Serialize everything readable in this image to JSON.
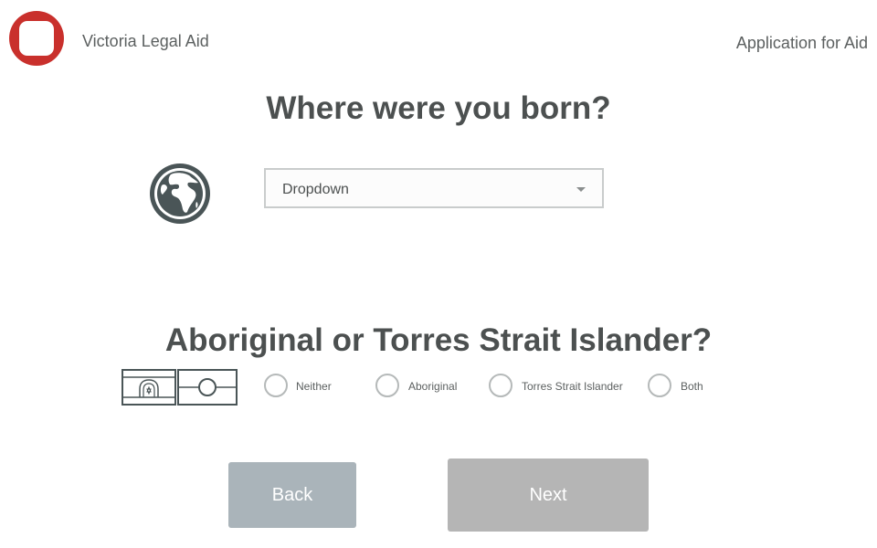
{
  "header": {
    "org_name": "Victoria Legal Aid",
    "app_title": "Application for Aid",
    "logo_icon": "vla-logo-icon",
    "brand_color": "#c9302c"
  },
  "birthplace": {
    "question": "Where were you born?",
    "icon": "globe-icon",
    "dropdown": {
      "value": "Dropdown"
    }
  },
  "indigenous": {
    "question": "Aboriginal or Torres Strait Islander?",
    "icon": "indigenous-flags-icon",
    "options": [
      {
        "label": "Neither"
      },
      {
        "label": "Aboriginal"
      },
      {
        "label": "Torres Strait Islander"
      },
      {
        "label": "Both"
      }
    ]
  },
  "nav": {
    "back_label": "Back",
    "next_label": "Next",
    "back_color": "#aab4ba",
    "next_color": "#b5b5b5"
  }
}
